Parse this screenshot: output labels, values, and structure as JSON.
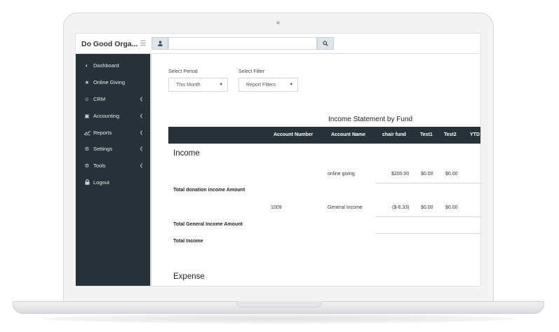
{
  "brand": {
    "title": "Do Good Orga...",
    "menu_icon": "hamburger-icon"
  },
  "search": {
    "value": "",
    "placeholder": "",
    "user_icon": "user-icon",
    "search_icon": "search-icon"
  },
  "sidebar": {
    "items": [
      {
        "label": "Dashboard",
        "icon": "dashboard-icon",
        "has_submenu": false
      },
      {
        "label": "Online Giving",
        "icon": "star-icon",
        "has_submenu": false
      },
      {
        "label": "CRM",
        "icon": "user-circle-icon",
        "has_submenu": true
      },
      {
        "label": "Accounting",
        "icon": "credit-card-icon",
        "has_submenu": true
      },
      {
        "label": "Reports",
        "icon": "line-chart-icon",
        "has_submenu": true
      },
      {
        "label": "Settings",
        "icon": "gears-icon",
        "has_submenu": true
      },
      {
        "label": "Tools",
        "icon": "cogs-icon",
        "has_submenu": true
      },
      {
        "label": "Logout",
        "icon": "lock-icon",
        "has_submenu": false
      }
    ]
  },
  "filters": {
    "period_label": "Select Period",
    "period_value": "This Month",
    "filter_label": "Select Filter",
    "filter_value": "Report Filters"
  },
  "report": {
    "title": "Income Statement by Fund",
    "columns": [
      "Account Number",
      "Account Name",
      "chair fund",
      "Test1",
      "Test2",
      "YTD"
    ],
    "income_heading": "Income",
    "rows": [
      {
        "account_number": "",
        "account_name": "online giving",
        "chair_fund": "$200.00",
        "test1": "$0.00",
        "test2": "$0.00"
      },
      {
        "account_number": "1009",
        "account_name": "General Income",
        "chair_fund": "($-6.33)",
        "test1": "$0.00",
        "test2": "$0.00"
      }
    ],
    "total_donation": "Total donation income Amount",
    "total_general": "Total General Income Amount",
    "total_income": "Total Income",
    "expense_heading": "Expense"
  },
  "colors": {
    "sidebar": "#263238",
    "header": "#263238",
    "accent_button": "#dfe5ea"
  }
}
